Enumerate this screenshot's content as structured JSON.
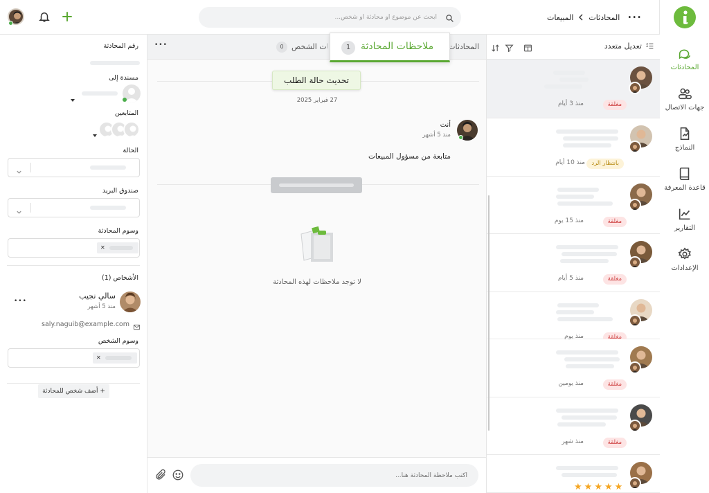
{
  "header": {
    "breadcrumb": {
      "root": "المحادثات",
      "current": "المبيعات"
    },
    "search_placeholder": "ابحث عن موضوع أو محادثة أو شخص...",
    "more_label": "•••"
  },
  "sidebar": {
    "items": [
      {
        "label": "المحادثات",
        "icon": "chat-icon",
        "active": true
      },
      {
        "label": "جهات الاتصال",
        "icon": "contacts-icon",
        "active": false
      },
      {
        "label": "النماذج",
        "icon": "forms-icon",
        "active": false
      },
      {
        "label": "قاعدة المعرفة",
        "icon": "book-icon",
        "active": false
      },
      {
        "label": "التقارير",
        "icon": "chart-icon",
        "active": false
      },
      {
        "label": "الإعدادات",
        "icon": "gear-icon",
        "active": false
      }
    ],
    "accent": "#5aa832"
  },
  "list": {
    "bulk_edit": "تعديل متعدد",
    "items": [
      {
        "status": "مغلقة",
        "status_type": "closed",
        "time": "منذ 3 أيام"
      },
      {
        "status": "بانتظار الرد",
        "status_type": "wait",
        "time": "منذ 10 أيام"
      },
      {
        "status": "مغلقة",
        "status_type": "closed",
        "time": "منذ 15 يوم"
      },
      {
        "status": "مغلقة",
        "status_type": "closed",
        "time": "منذ 5 أيام"
      },
      {
        "status": "مغلقة",
        "status_type": "closed",
        "time": "منذ يوم"
      },
      {
        "status": "مغلقة",
        "status_type": "closed",
        "time": "منذ يومين"
      },
      {
        "status": "مغلقة",
        "status_type": "closed",
        "time": "منذ شهر"
      },
      {
        "rating": 5
      }
    ]
  },
  "middle": {
    "tabs": [
      {
        "label": "المحادثات"
      },
      {
        "label": "ملاحظات المحادثة",
        "count": "1",
        "active": true
      },
      {
        "label": "ملاحظات الشخص",
        "count": "0"
      }
    ],
    "tooltip": "تحديث حالة الطلب",
    "date": "27 فبراير 2025",
    "message": {
      "author": "أنت",
      "time": "منذ 5 أشهر",
      "text": "متابعة من مسؤول المبيعات"
    },
    "empty_text": "لا توجد ملاحظات لهذه المحادثة",
    "composer_placeholder": "اكتب ملاحظة المحادثة هنا..."
  },
  "details": {
    "conversation_number_label": "رقم المحادثة",
    "assigned_label": "مسندة إلى",
    "followers_label": "المتابعين",
    "status_label": "الحالة",
    "mailbox_label": "صندوق البريد",
    "conversation_tags_label": "وسوم المحادثة",
    "people_label": "الأشخاص (1)",
    "person": {
      "name": "سالي نجيب",
      "time": "منذ 5 أشهر",
      "email": "saly.naguib@example.com"
    },
    "person_tags_label": "وسوم الشخص",
    "add_person_button": "+ أضف شخص للمحادثة",
    "more_label": "•••"
  }
}
